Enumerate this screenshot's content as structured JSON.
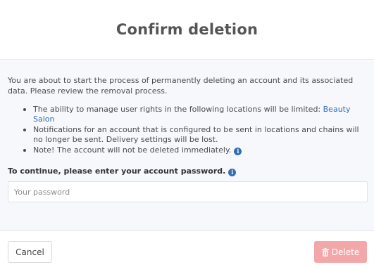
{
  "dialog": {
    "title": "Confirm deletion",
    "intro": "You are about to start the process of permanently deleting an account and its associated data. Please review the removal process.",
    "bullets": [
      {
        "text": "The ability to manage user rights in the following locations will be limited: ",
        "link": "Beauty Salon"
      },
      {
        "text": "Notifications for an account that is configured to be sent in locations and chains will no longer be sent. Delivery settings will be lost."
      },
      {
        "text": "Note! The account will not be deleted immediately.",
        "icon": "info-icon"
      }
    ],
    "password": {
      "label": "To continue, please enter your account password.",
      "label_icon": "info-icon",
      "placeholder": "Your password",
      "value": ""
    },
    "buttons": {
      "cancel": "Cancel",
      "delete": "Delete",
      "delete_icon": "trash-icon"
    },
    "colors": {
      "link": "#2f6fb5",
      "delete_button": "#f4a7a9",
      "body_background": "#f6f8fc"
    }
  }
}
